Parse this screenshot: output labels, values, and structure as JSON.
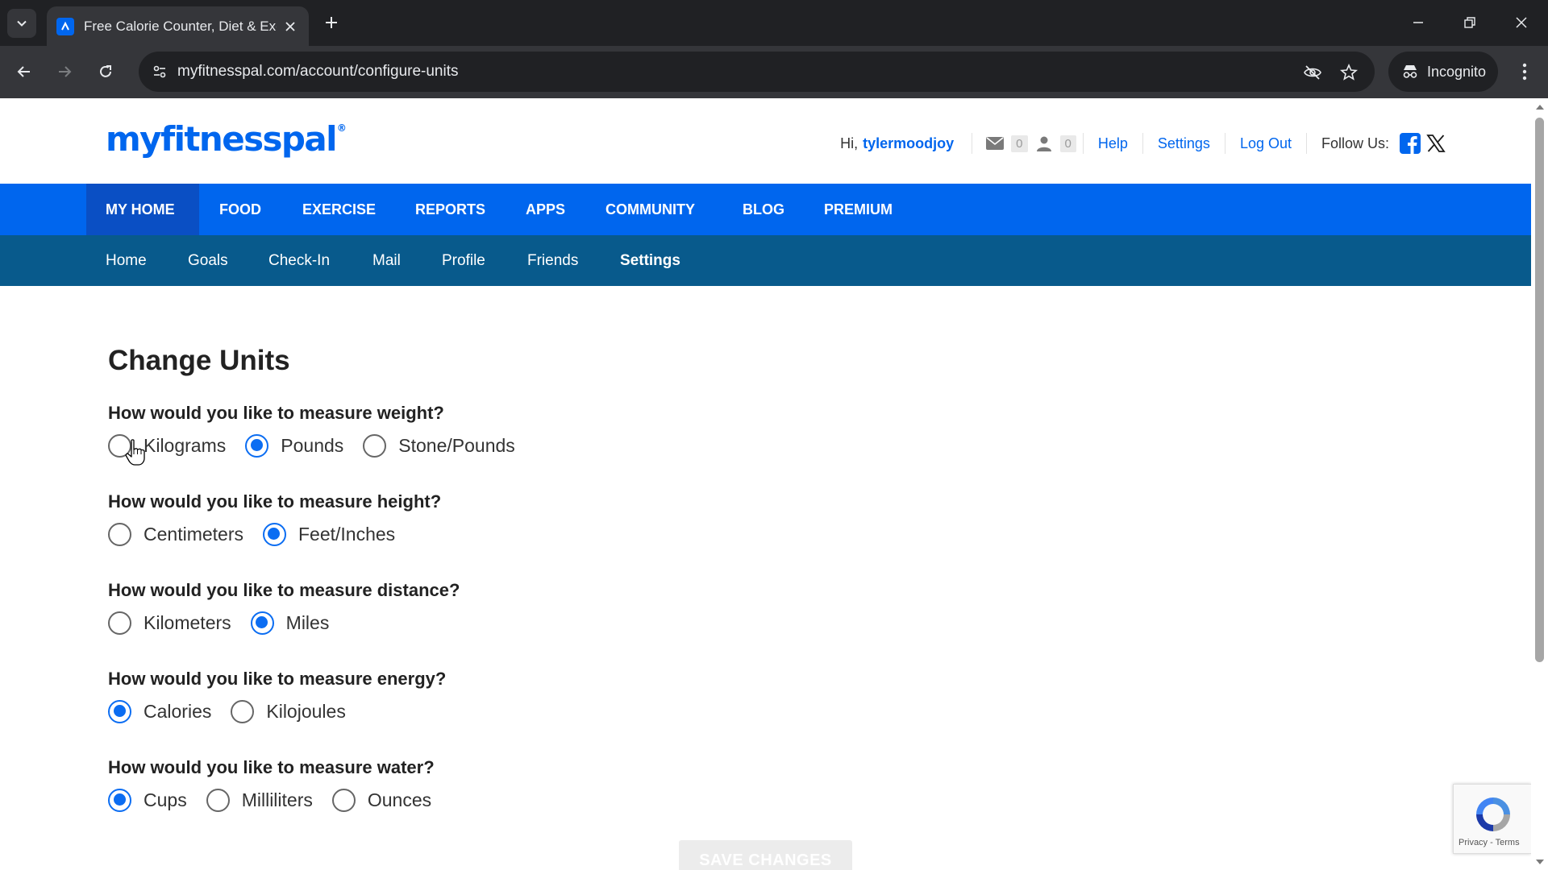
{
  "browser": {
    "tab_title": "Free Calorie Counter, Diet & Exercise",
    "url": "myfitnesspal.com/account/configure-units",
    "incognito_label": "Incognito"
  },
  "site": {
    "logo_text": "myfitnesspal",
    "logo_mark": "®",
    "greeting": "Hi,",
    "username": "tylermoodjoy",
    "mail_count": "0",
    "friend_count": "0",
    "help_link": "Help",
    "settings_link": "Settings",
    "logout_link": "Log Out",
    "follow_label": "Follow Us:"
  },
  "main_nav": [
    "MY HOME",
    "FOOD",
    "EXERCISE",
    "REPORTS",
    "APPS",
    "COMMUNITY",
    "BLOG",
    "PREMIUM"
  ],
  "main_nav_active": "MY HOME",
  "sub_nav": [
    "Home",
    "Goals",
    "Check-In",
    "Mail",
    "Profile",
    "Friends",
    "Settings"
  ],
  "sub_nav_active": "Settings",
  "form": {
    "title": "Change Units",
    "questions": [
      {
        "label": "How would you like to measure weight?",
        "options": [
          "Kilograms",
          "Pounds",
          "Stone/Pounds"
        ],
        "selected": "Pounds"
      },
      {
        "label": "How would you like to measure height?",
        "options": [
          "Centimeters",
          "Feet/Inches"
        ],
        "selected": "Feet/Inches"
      },
      {
        "label": "How would you like to measure distance?",
        "options": [
          "Kilometers",
          "Miles"
        ],
        "selected": "Miles"
      },
      {
        "label": "How would you like to measure energy?",
        "options": [
          "Calories",
          "Kilojoules"
        ],
        "selected": "Calories"
      },
      {
        "label": "How would you like to measure water?",
        "options": [
          "Cups",
          "Milliliters",
          "Ounces"
        ],
        "selected": "Cups"
      }
    ],
    "save_label": "SAVE CHANGES"
  },
  "recaptcha": {
    "links": "Privacy - Terms"
  },
  "colors": {
    "brand": "#0066ee",
    "subnav": "#085a8c",
    "chrome_dark": "#202124",
    "chrome_mid": "#35363a"
  }
}
